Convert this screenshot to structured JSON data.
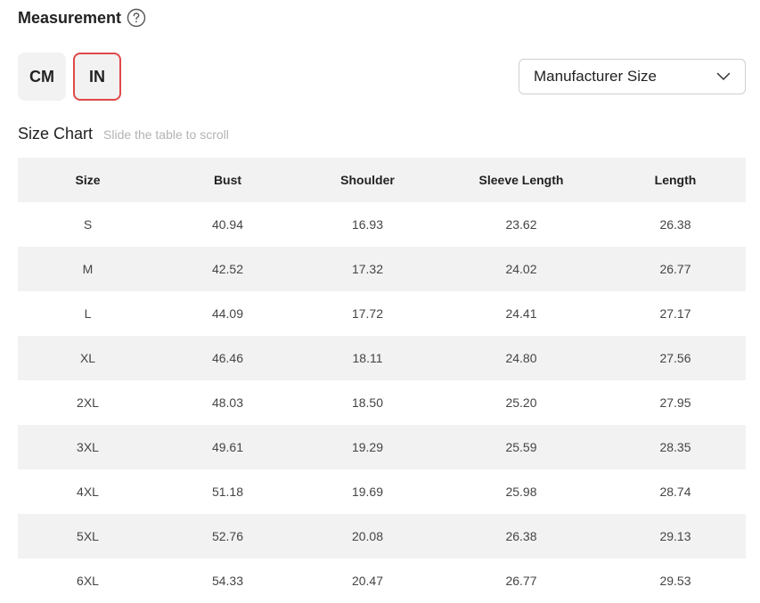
{
  "measurement": {
    "title": "Measurement",
    "help_icon": "question-circle-icon"
  },
  "units": [
    {
      "label": "CM",
      "active": false
    },
    {
      "label": "IN",
      "active": true
    }
  ],
  "size_select": {
    "value": "Manufacturer Size",
    "icon": "chevron-down-icon"
  },
  "size_chart": {
    "title": "Size Chart",
    "hint": "Slide the table to scroll"
  },
  "colors": {
    "accent": "#e04848",
    "row_alt": "#f2f2f2",
    "hint_text": "#b3b3b3"
  },
  "table": {
    "headers": [
      "Size",
      "Bust",
      "Shoulder",
      "Sleeve Length",
      "Length"
    ],
    "rows": [
      [
        "S",
        "40.94",
        "16.93",
        "23.62",
        "26.38"
      ],
      [
        "M",
        "42.52",
        "17.32",
        "24.02",
        "26.77"
      ],
      [
        "L",
        "44.09",
        "17.72",
        "24.41",
        "27.17"
      ],
      [
        "XL",
        "46.46",
        "18.11",
        "24.80",
        "27.56"
      ],
      [
        "2XL",
        "48.03",
        "18.50",
        "25.20",
        "27.95"
      ],
      [
        "3XL",
        "49.61",
        "19.29",
        "25.59",
        "28.35"
      ],
      [
        "4XL",
        "51.18",
        "19.69",
        "25.98",
        "28.74"
      ],
      [
        "5XL",
        "52.76",
        "20.08",
        "26.38",
        "29.13"
      ],
      [
        "6XL",
        "54.33",
        "20.47",
        "26.77",
        "29.53"
      ]
    ]
  }
}
